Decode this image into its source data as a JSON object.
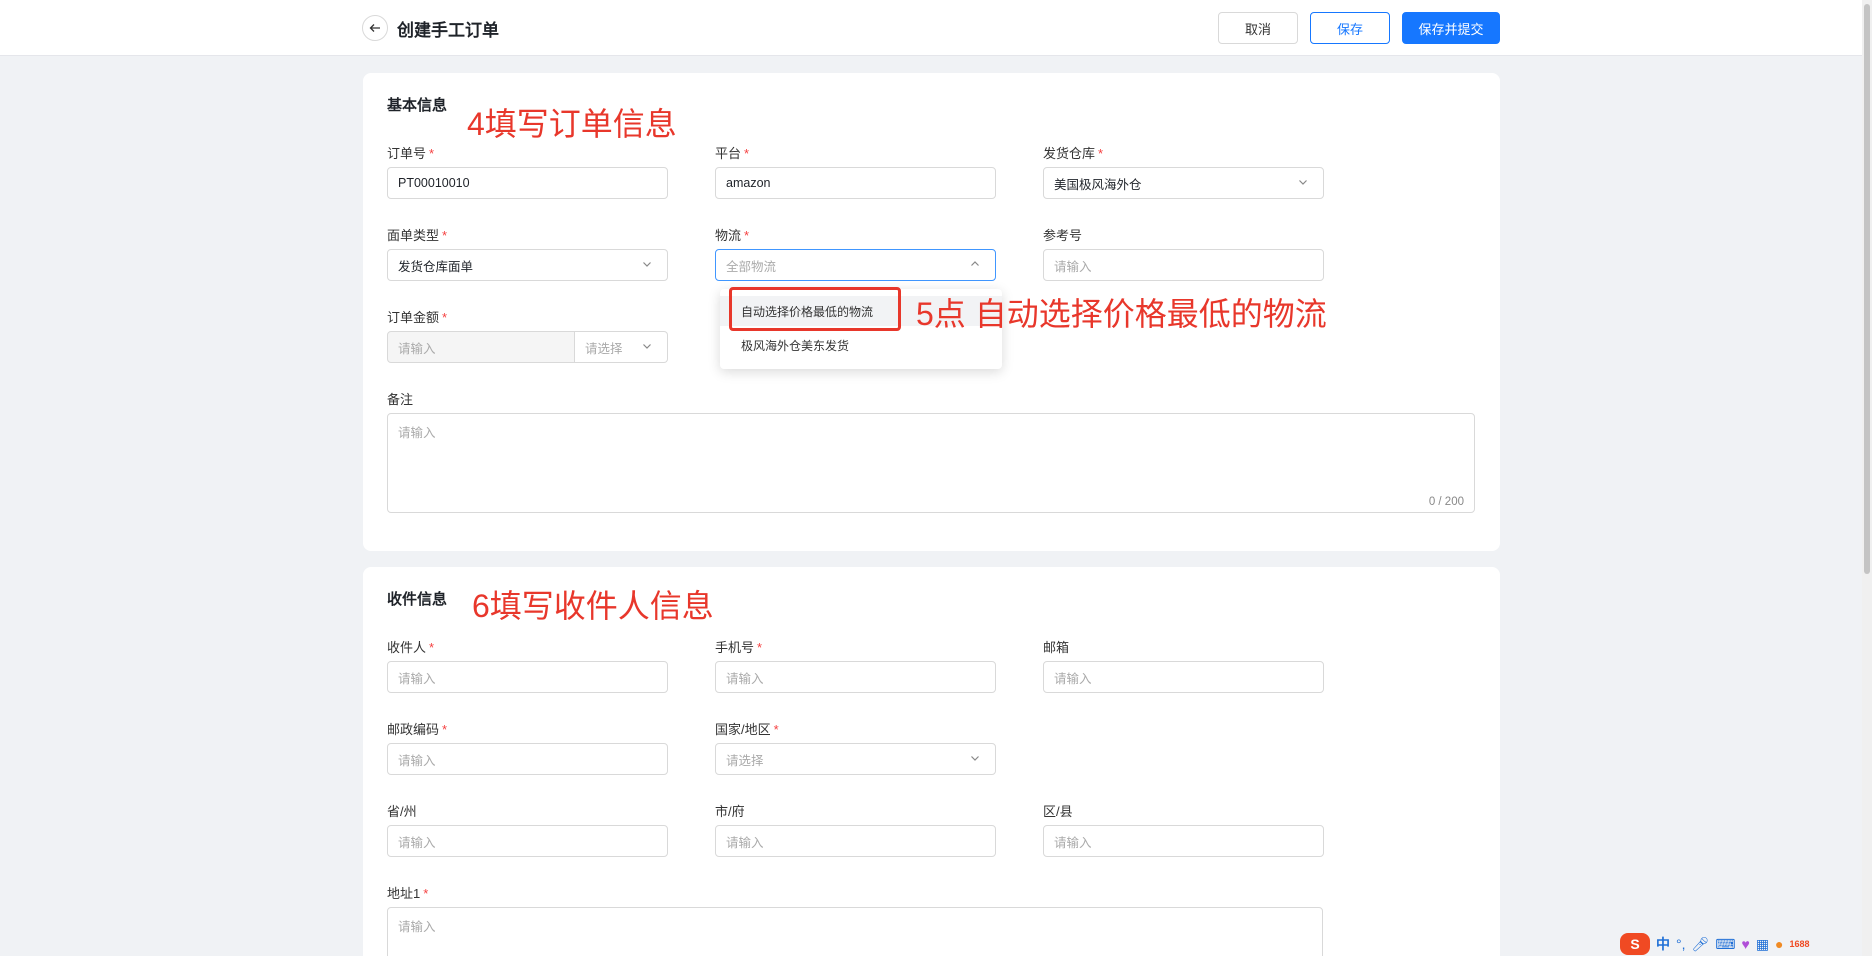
{
  "header": {
    "title": "创建手工订单",
    "cancel_label": "取消",
    "save_label": "保存",
    "submit_label": "保存并提交"
  },
  "basic": {
    "section_title": "基本信息",
    "annotation": "4填写订单信息",
    "order_no": {
      "label": "订单号",
      "value": "PT00010010"
    },
    "platform": {
      "label": "平台",
      "value": "amazon"
    },
    "warehouse": {
      "label": "发货仓库",
      "value": "美国极风海外仓"
    },
    "label_type": {
      "label": "面单类型",
      "value": "发货仓库面单"
    },
    "logistics": {
      "label": "物流",
      "placeholder": "全部物流"
    },
    "reference": {
      "label": "参考号",
      "placeholder": "请输入"
    },
    "amount": {
      "label": "订单金额",
      "placeholder": "请输入",
      "currency_placeholder": "请选择"
    },
    "remark": {
      "label": "备注",
      "placeholder": "请输入",
      "counter": "0 / 200"
    }
  },
  "logistics_dropdown": {
    "options": [
      "自动选择价格最低的物流",
      "极风海外仓美东发货"
    ],
    "annotation": "5点 自动选择价格最低的物流"
  },
  "receiver": {
    "section_title": "收件信息",
    "annotation": "6填写收件人信息",
    "name": {
      "label": "收件人",
      "placeholder": "请输入"
    },
    "phone": {
      "label": "手机号",
      "placeholder": "请输入"
    },
    "email": {
      "label": "邮箱",
      "placeholder": "请输入"
    },
    "zip": {
      "label": "邮政编码",
      "placeholder": "请输入"
    },
    "country": {
      "label": "国家/地区",
      "placeholder": "请选择"
    },
    "province": {
      "label": "省/州",
      "placeholder": "请输入"
    },
    "city": {
      "label": "市/府",
      "placeholder": "请输入"
    },
    "district": {
      "label": "区/县",
      "placeholder": "请输入"
    },
    "address1": {
      "label": "地址1",
      "placeholder": "请输入"
    }
  },
  "required_mark": "*",
  "ime": {
    "lang": "中",
    "badge": "1688"
  },
  "colors": {
    "primary": "#1677ff",
    "annotation": "#e8372b",
    "required": "#f53f3f"
  }
}
